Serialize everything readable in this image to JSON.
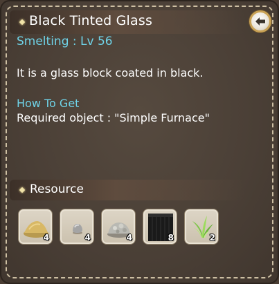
{
  "header": {
    "title": "Black Tinted Glass",
    "subtitle": "Smelting : Lv 56"
  },
  "body": {
    "description": "It is a glass block coated in black.",
    "how_to_get_label": "How To Get",
    "required": "Required object : \"Simple Furnace\""
  },
  "resource": {
    "label": "Resource",
    "items": [
      {
        "icon": "sand-pile-icon",
        "count": "4"
      },
      {
        "icon": "small-stone-icon",
        "count": "4"
      },
      {
        "icon": "stone-pile-icon",
        "count": "4"
      },
      {
        "icon": "black-block-icon",
        "count": "8"
      },
      {
        "icon": "grass-icon",
        "count": "2"
      }
    ]
  },
  "colors": {
    "accent_cyan": "#6fd3e8",
    "panel_brown": "#4a3f36",
    "stitch": "#cdbfa3",
    "button_ring": "#c9a255"
  }
}
